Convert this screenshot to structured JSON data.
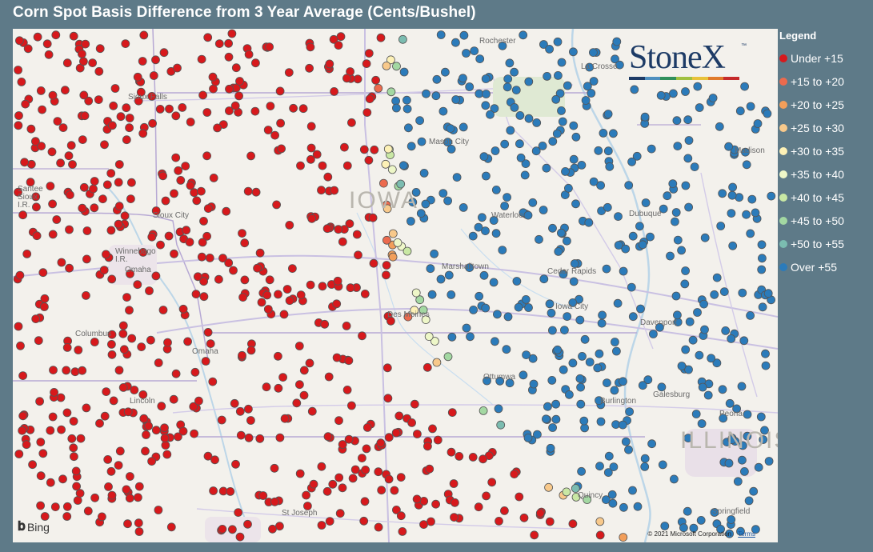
{
  "title": "Corn Spot Basis Difference from 3 Year Average (Cents/Bushel)",
  "legend": {
    "title": "Legend",
    "items": [
      {
        "label": "Under +15",
        "color": "#d7191c"
      },
      {
        "label": "+15 to +20",
        "color": "#ec6a4d"
      },
      {
        "label": "+20 to +25",
        "color": "#f29e5a"
      },
      {
        "label": "+25 to +30",
        "color": "#f8c98b"
      },
      {
        "label": "+30 to +35",
        "color": "#fdf1b6"
      },
      {
        "label": "+35 to +40",
        "color": "#eef7c8"
      },
      {
        "label": "+40 to +45",
        "color": "#c9e8a4"
      },
      {
        "label": "+45 to +50",
        "color": "#a3d8a2"
      },
      {
        "label": "+50 to +55",
        "color": "#7bbcb0"
      },
      {
        "label": "Over +55",
        "color": "#2b7bba"
      }
    ]
  },
  "logo": {
    "text": "StoneX",
    "tm": "™",
    "stripe_colors": [
      "#1d3b66",
      "#4e8fbf",
      "#2f8f5b",
      "#a0c040",
      "#e8c23a",
      "#e07a2a",
      "#c52a2a"
    ]
  },
  "map": {
    "state_labels": [
      "IOWA",
      "ILLINOIS"
    ],
    "cities": [
      "Rochester",
      "La Crosse",
      "Sioux Falls",
      "Mason City",
      "Madison",
      "Santee Sioux I.R.",
      "Sioux City",
      "Waterloo",
      "Dubuque",
      "Winnebago I.R.",
      "Omaha",
      "Marshalltown",
      "Cedar Rapids",
      "Iowa City",
      "Des Moines",
      "Davenport",
      "Columbus",
      "Omaha",
      "Ottumwa",
      "Lincoln",
      "Burlington",
      "Galesburg",
      "Peoria",
      "St Joseph",
      "Springfield",
      "Quincy"
    ],
    "attribution": "© 2021 Microsoft Corporation",
    "terms": "Terms",
    "bing": "Bing"
  }
}
